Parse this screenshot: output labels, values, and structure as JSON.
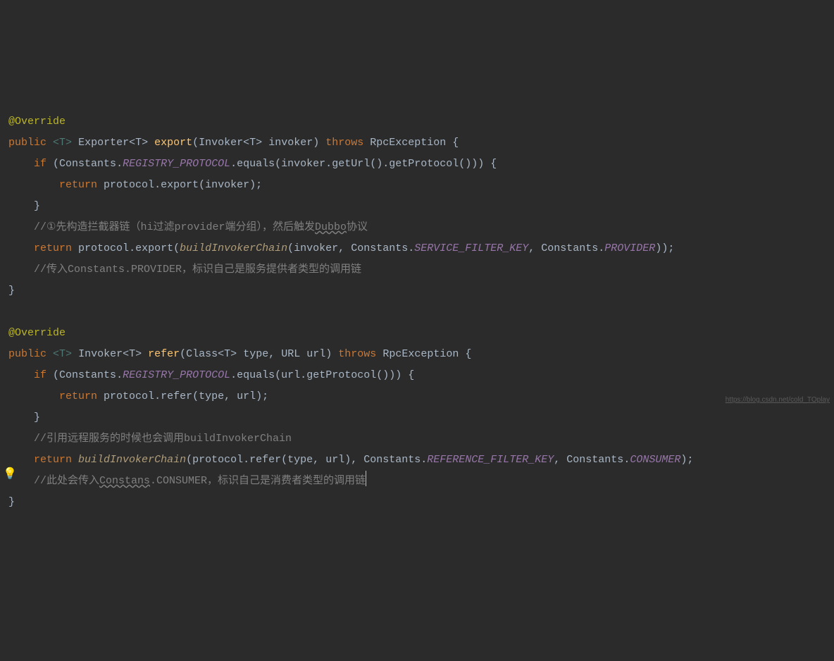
{
  "code": {
    "ann1": "@Override",
    "l1": {
      "public": "public",
      "T": "<T>",
      "Exporter": "Exporter",
      "T2": "<T>",
      "export": "export",
      "Invoker": "Invoker",
      "T3": "<T>",
      "invoker": "invoker",
      "throws": "throws",
      "RpcException": "RpcException"
    },
    "l2": {
      "if": "if",
      "Constants": "Constants",
      "REGISTRY_PROTOCOL": "REGISTRY_PROTOCOL",
      "equals": "equals",
      "invoker": "invoker",
      "getUrl": "getUrl",
      "getProtocol": "getProtocol"
    },
    "l3": {
      "return": "return",
      "protocol": "protocol",
      "export": "export",
      "invoker": "invoker"
    },
    "cmt1": "//①先构造拦截器链（hi过滤provider端分组），然后触发",
    "cmt1_dubbo": "Dubbo",
    "cmt1_tail": "协议",
    "l4": {
      "return": "return",
      "protocol": "protocol",
      "export": "export",
      "buildInvokerChain": "buildInvokerChain",
      "invoker": "invoker",
      "Constants": "Constants",
      "SERVICE_FILTER_KEY": "SERVICE_FILTER_KEY",
      "Constants2": "Constants",
      "PROVIDER": "PROVIDER"
    },
    "cmt2": "//传入Constants.PROVIDER，标识自己是服务提供者类型的调用链",
    "ann2": "@Override",
    "l5": {
      "public": "public",
      "T": "<T>",
      "Invoker": "Invoker",
      "T2": "<T>",
      "refer": "refer",
      "Class": "Class",
      "T3": "<T>",
      "type": "type",
      "URL": "URL",
      "url": "url",
      "throws": "throws",
      "RpcException": "RpcException"
    },
    "l6": {
      "if": "if",
      "Constants": "Constants",
      "REGISTRY_PROTOCOL": "REGISTRY_PROTOCOL",
      "equals": "equals",
      "url": "url",
      "getProtocol": "getProtocol"
    },
    "l7": {
      "return": "return",
      "protocol": "protocol",
      "refer": "refer",
      "type": "type",
      "url": "url"
    },
    "cmt3": "//引用远程服务的时候也会调用buildInvokerChain",
    "l8": {
      "return": "return",
      "buildInvokerChain": "buildInvokerChain",
      "protocol": "protocol",
      "refer": "refer",
      "type": "type",
      "url": "url",
      "Constants": "Constants",
      "REFERENCE_FILTER_KEY": "REFERENCE_FILTER_KEY",
      "Constants2": "Constants",
      "CONSUMER": "CONSUMER"
    },
    "cmt4_a": "//此处会传入",
    "cmt4_b": "Constans",
    "cmt4_c": ".CONSUMER，标识自己是消费者类型的调用链"
  },
  "watermark": "https://blog.csdn.net/cold_TOplay"
}
